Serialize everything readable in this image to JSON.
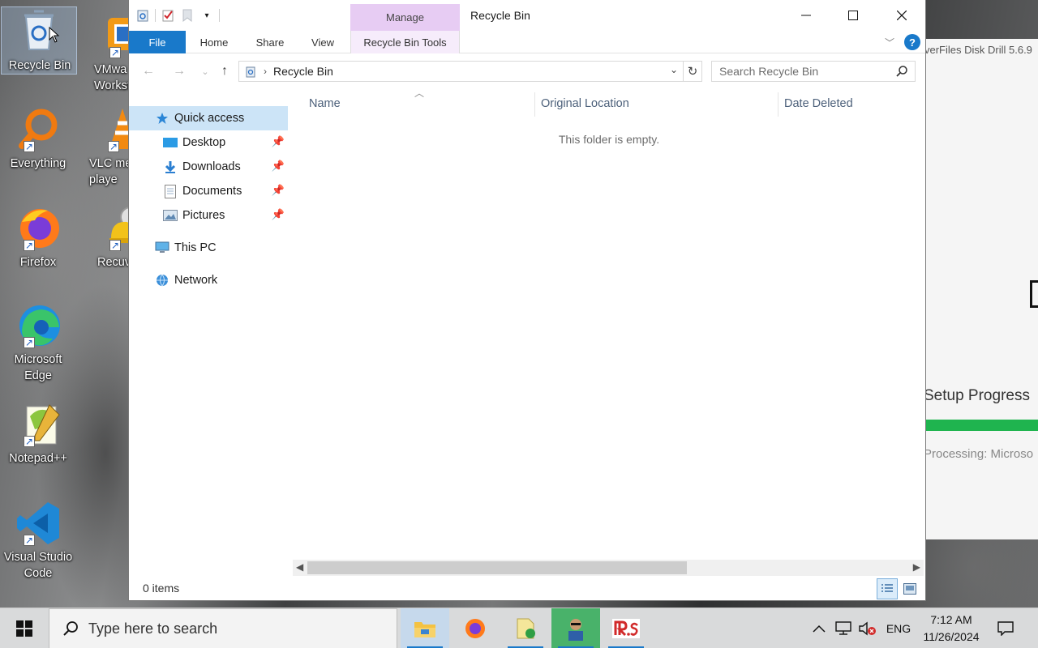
{
  "desktop": {
    "icons": [
      {
        "label": "Recycle Bin"
      },
      {
        "label": "VMwa\nWorksta"
      },
      {
        "label": "Everything"
      },
      {
        "label": "VLC me\nplaye"
      },
      {
        "label": "Firefox"
      },
      {
        "label": "Recuv"
      },
      {
        "label": "Microsoft\nEdge"
      },
      {
        "label": "Notepad++"
      },
      {
        "label": "Visual Studio\nCode"
      }
    ]
  },
  "background_app": {
    "title": "verFiles Disk Drill 5.6.9",
    "setup_label": "Setup Progress",
    "processing_label": "Processing:  Microso",
    "progress_color": "#1fb44f"
  },
  "explorer": {
    "title": "Recycle Bin",
    "context_tab": "Manage",
    "ribbon_tabs": {
      "file": "File",
      "home": "Home",
      "share": "Share",
      "view": "View",
      "tools": "Recycle Bin Tools"
    },
    "help": "?",
    "address": {
      "crumb": "Recycle Bin"
    },
    "search": {
      "placeholder": "Search Recycle Bin"
    },
    "nav": {
      "quick_access": "Quick access",
      "desktop": "Desktop",
      "downloads": "Downloads",
      "documents": "Documents",
      "pictures": "Pictures",
      "this_pc": "This PC",
      "network": "Network"
    },
    "columns": {
      "name": "Name",
      "original_location": "Original Location",
      "date_deleted": "Date Deleted"
    },
    "empty_message": "This folder is empty.",
    "status": {
      "item_count": "0 items"
    },
    "accent_color": "#1979ca",
    "context_tab_color": "#e7ccf3"
  },
  "taskbar": {
    "search_placeholder": "Type here to search",
    "language": "ENG",
    "time": "7:12 AM",
    "date": "11/26/2024"
  }
}
